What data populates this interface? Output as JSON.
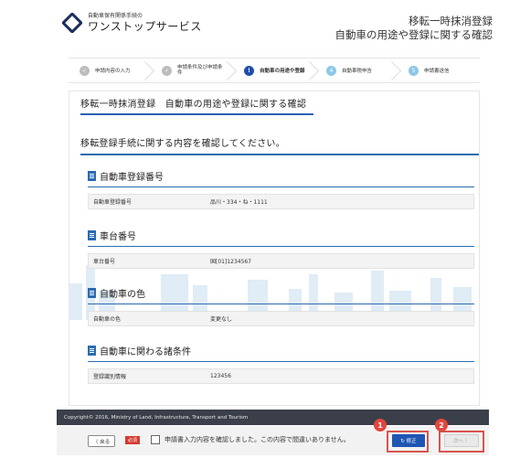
{
  "header": {
    "logo_small": "自動車保有関係手続の",
    "logo_main": "ワンストップサービス",
    "title_line1": "移転一時抹消登録",
    "title_line2": "自動車の用途や登録に関する確認"
  },
  "stepper": {
    "steps": [
      {
        "num": "✓",
        "label": "申請内容の入力",
        "state": "done"
      },
      {
        "num": "✓",
        "label": "申請条件及び申請条\n件",
        "state": "done"
      },
      {
        "num": "!",
        "label": "自動車の用途や登録",
        "state": "active"
      },
      {
        "num": "4",
        "label": "自動車税申告",
        "state": "todo"
      },
      {
        "num": "5",
        "label": "申請書送信",
        "state": "todo"
      }
    ]
  },
  "main": {
    "page_title": "移転一時抹消登録　自動車の用途や登録に関する確認",
    "instruction": "移転登録手続に関する内容を確認してください。",
    "sections": [
      {
        "heading": "自動車登録番号",
        "label": "自動車登録番号",
        "value": "品川・334・ね・1111"
      },
      {
        "heading": "車台番号",
        "label": "車台番号",
        "value": "国[01]1234567"
      },
      {
        "heading": "自動車の色",
        "label": "自動車の色",
        "value": "変更なし"
      },
      {
        "heading": "自動車に関わる諸条件",
        "label": "登録識別情報",
        "value": "123456"
      }
    ]
  },
  "footer": {
    "copyright": "Copyright© 2016, Ministry of Land, Infrastructure, Transport and Tourism",
    "back_label": "〈 戻る",
    "required_badge": "必須",
    "confirm_text": "申請書入力内容を確認しました。この内容で間違いありません。",
    "fix_label": "↻ 修正",
    "next_label": "次へ 〉",
    "marker1": "1",
    "marker2": "2"
  },
  "colors": {
    "accent": "#1f56b3",
    "highlight": "#d9534f",
    "footer_dark": "#3a3f4a"
  }
}
